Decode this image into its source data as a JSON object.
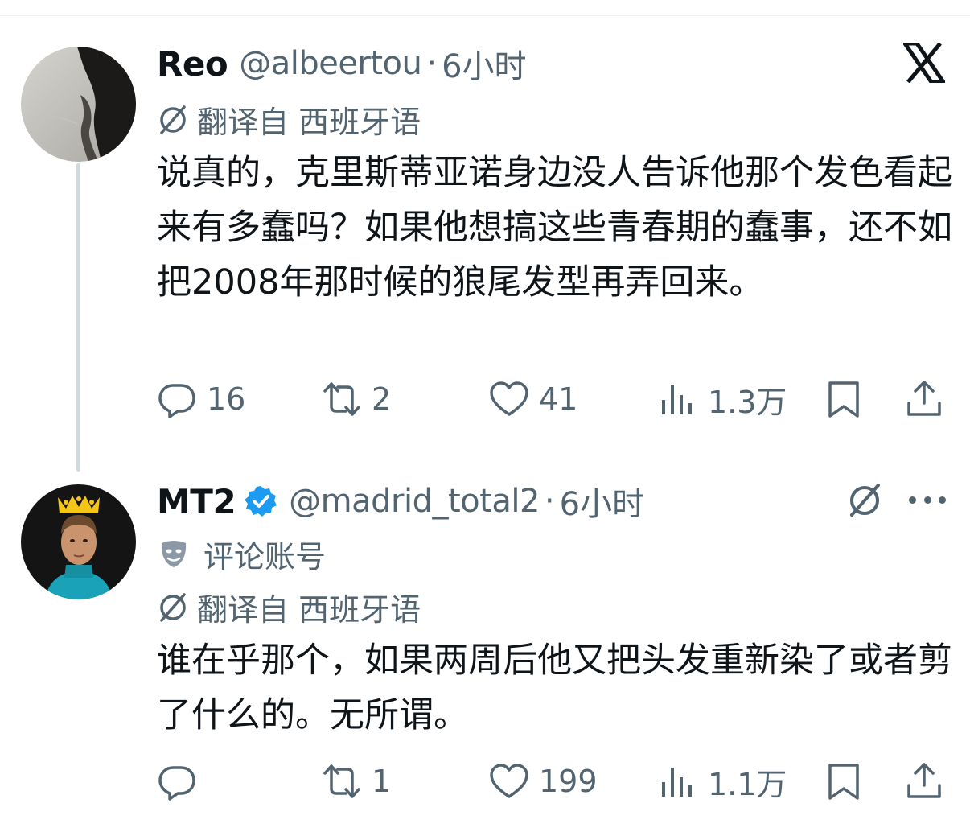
{
  "tweets": [
    {
      "name": "Reo",
      "handle": "@albeertou",
      "time": "6小时",
      "translated_from": "翻译自 西班牙语",
      "text": "说真的，克里斯蒂亚诺身边没人告诉他那个发色看起来有多蠢吗？如果他想搞这些青春期的蠢事，还不如把2008年那时候的狼尾发型再弄回来。",
      "replies": "16",
      "reposts": "2",
      "likes": "41",
      "views": "1.3万"
    },
    {
      "name": "MT2",
      "handle": "@madrid_total2",
      "time": "6小时",
      "account_label": "评论账号",
      "translated_from": "翻译自 西班牙语",
      "text": "谁在乎那个，如果两周后他又把头发重新染了或者剪了什么的。无所谓。",
      "replies": "",
      "reposts": "1",
      "likes": "199",
      "views": "1.1万"
    }
  ],
  "separator": "·",
  "colors": {
    "text_primary": "#0f1419",
    "text_secondary": "#536471",
    "verified_blue": "#1d9bf0",
    "thread_line": "#cfd9de"
  },
  "icons": [
    "x-logo-icon",
    "translate-icon",
    "verified-badge-icon",
    "reply-icon",
    "repost-icon",
    "like-icon",
    "views-icon",
    "bookmark-icon",
    "share-icon",
    "more-icon",
    "mask-icon"
  ]
}
